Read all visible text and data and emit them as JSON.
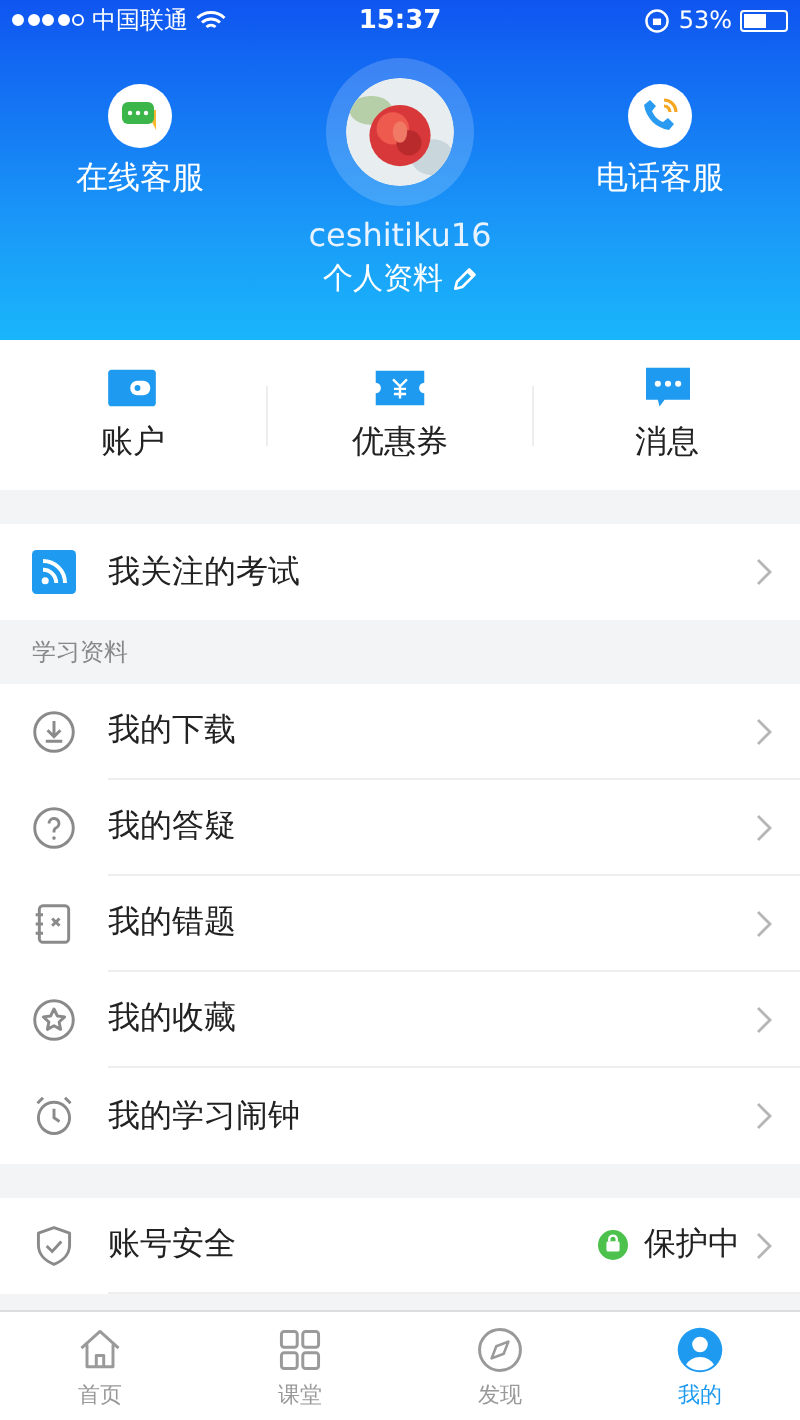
{
  "status_bar": {
    "carrier": "中国联通",
    "time": "15:37",
    "battery": "53%"
  },
  "header": {
    "left_action": {
      "label": "在线客服"
    },
    "right_action": {
      "label": "电话客服"
    },
    "username": "ceshitiku16",
    "profile_link": "个人资料"
  },
  "shortcuts": [
    {
      "kind": "wallet",
      "label": "账户"
    },
    {
      "kind": "coupon",
      "label": "优惠券"
    },
    {
      "kind": "message",
      "label": "消息"
    }
  ],
  "groups": [
    {
      "items": [
        {
          "kind": "rss",
          "label": "我关注的考试"
        }
      ]
    },
    {
      "title": "学习资料",
      "items": [
        {
          "kind": "download",
          "label": "我的下载"
        },
        {
          "kind": "question",
          "label": "我的答疑"
        },
        {
          "kind": "mistakes",
          "label": "我的错题"
        },
        {
          "kind": "star",
          "label": "我的收藏"
        },
        {
          "kind": "alarm",
          "label": "我的学习闹钟"
        }
      ]
    },
    {
      "items": [
        {
          "kind": "shield",
          "label": "账号安全",
          "status": "保护中"
        }
      ]
    }
  ],
  "tab_bar": [
    {
      "kind": "home",
      "label": "首页",
      "selected": false
    },
    {
      "kind": "grid",
      "label": "课堂",
      "selected": false
    },
    {
      "kind": "compass",
      "label": "发现",
      "selected": false
    },
    {
      "kind": "person",
      "label": "我的",
      "selected": true
    }
  ]
}
